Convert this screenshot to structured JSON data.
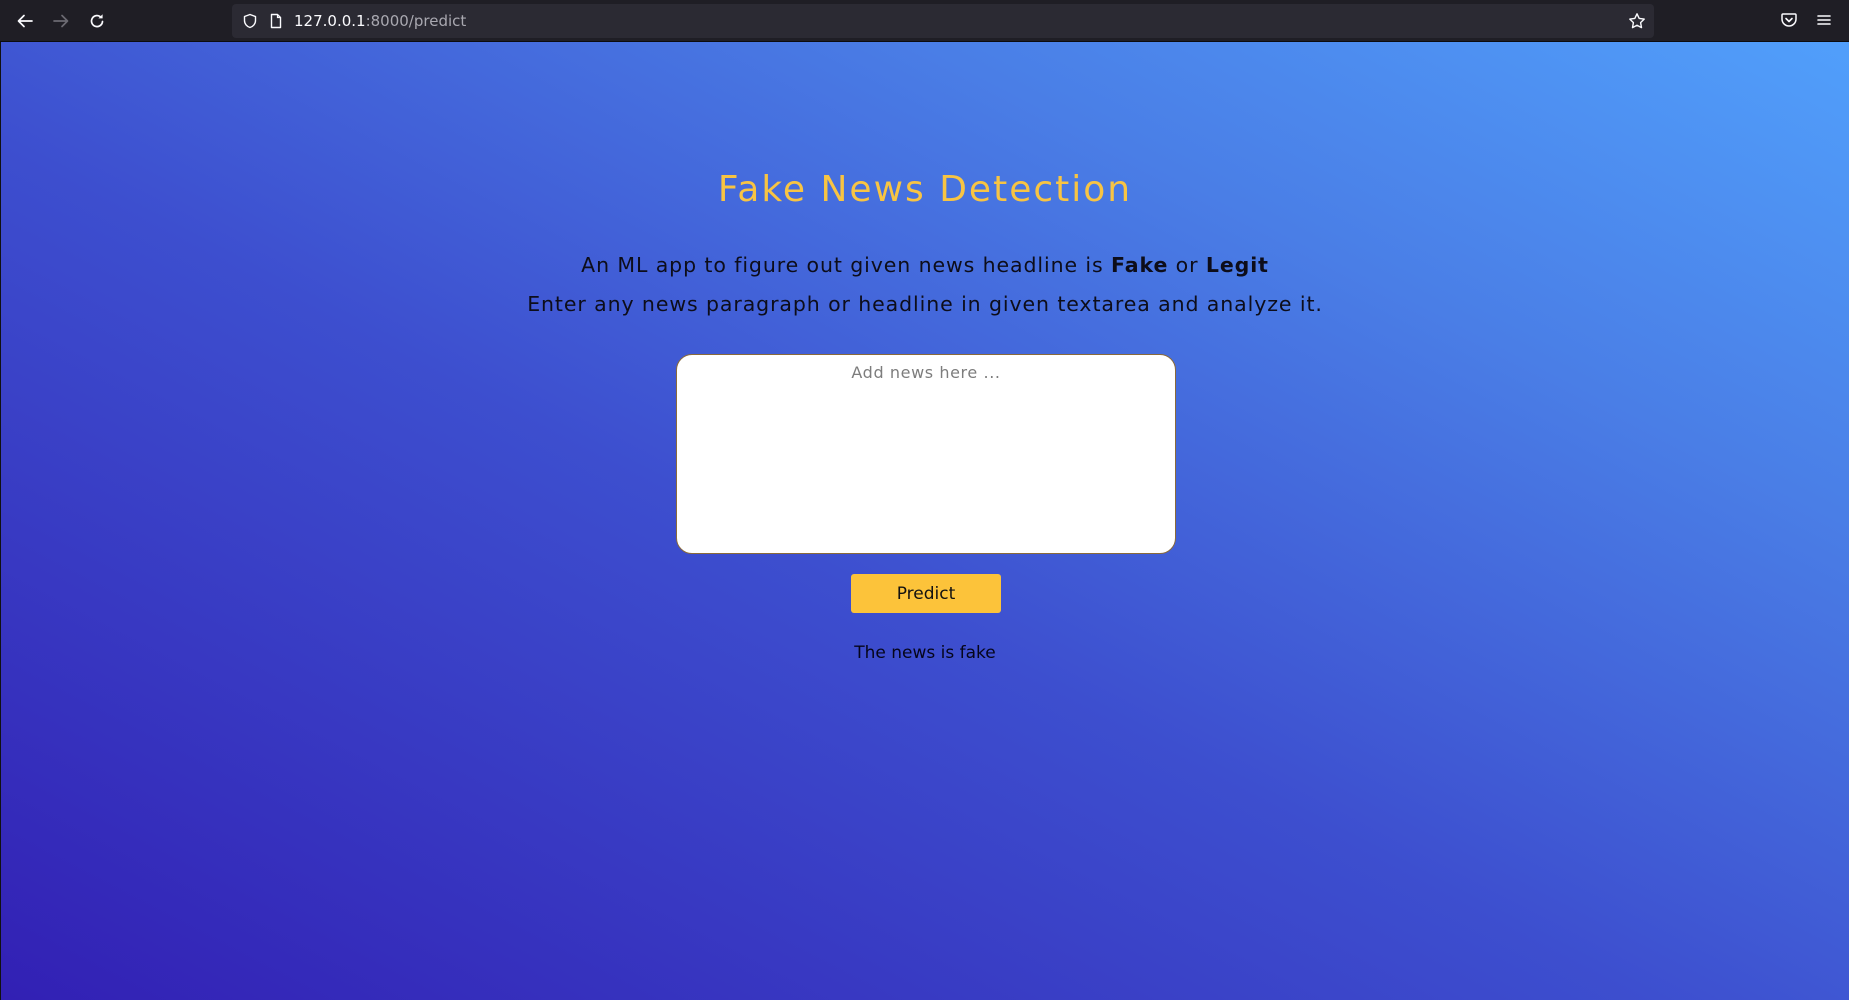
{
  "browser": {
    "url_host": "127.0.0.1",
    "url_rest": ":8000/predict",
    "icons": [
      "back-icon",
      "forward-icon",
      "reload-icon",
      "shield-icon",
      "page-icon",
      "bookmark-star-icon",
      "pocket-icon",
      "menu-icon"
    ]
  },
  "app": {
    "title": "Fake News Detection",
    "desc_line1_prefix": "An ML app to figure out given news headline is ",
    "desc_fake": "Fake",
    "desc_or": " or ",
    "desc_legit": "Legit",
    "desc_line2": "Enter any news paragraph or headline in given textarea and analyze it.",
    "input_placeholder": "Add news here ...",
    "input_value": "",
    "predict_label": "Predict",
    "result_text": "The news is fake"
  },
  "colors": {
    "title": "#f8c443",
    "button": "#fcc33a",
    "gradient_start": "#3220b4",
    "gradient_end": "#519ffb"
  }
}
